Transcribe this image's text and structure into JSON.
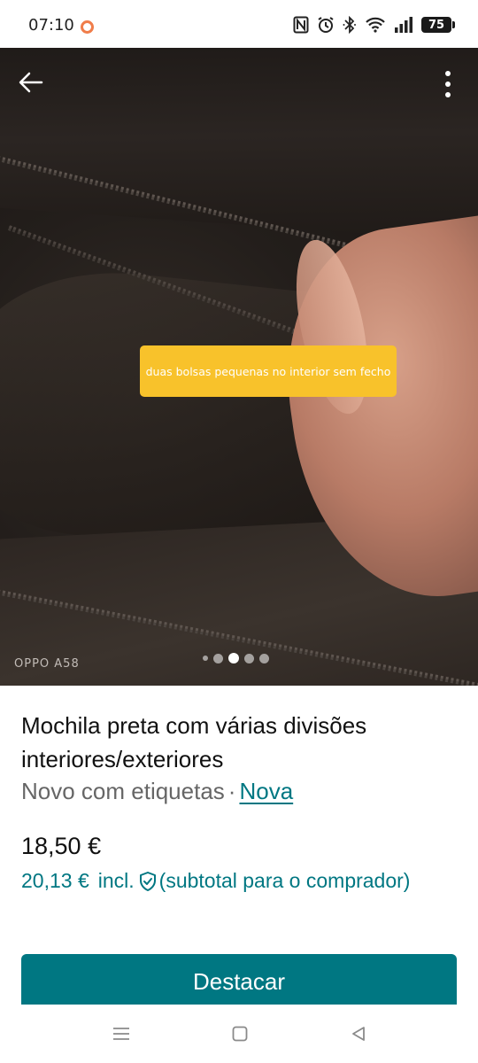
{
  "status_bar": {
    "time": "07:10",
    "battery": "75",
    "icons": [
      "notification-dot-icon",
      "nfc-icon",
      "alarm-icon",
      "bluetooth-icon",
      "wifi-icon",
      "signal-icon",
      "battery-icon"
    ]
  },
  "photo": {
    "note": "duas bolsas pequenas no interior sem fecho",
    "watermark": "OPPO A58",
    "carousel": {
      "count": 5,
      "active_index": 2
    }
  },
  "listing": {
    "title": "Mochila preta com várias divisões interiores/exteriores",
    "condition": "Novo com etiquetas",
    "separator": "·",
    "status_link": "Nova",
    "price": "18,50 €",
    "buyer_price": "20,13 €",
    "buyer_incl": "incl.",
    "buyer_note": "(subtotal para o comprador)"
  },
  "actions": {
    "primary_button": "Destacar"
  },
  "colors": {
    "accent": "#007782",
    "note_bg": "#f8c22b",
    "status_dot": "#f07d4a"
  }
}
